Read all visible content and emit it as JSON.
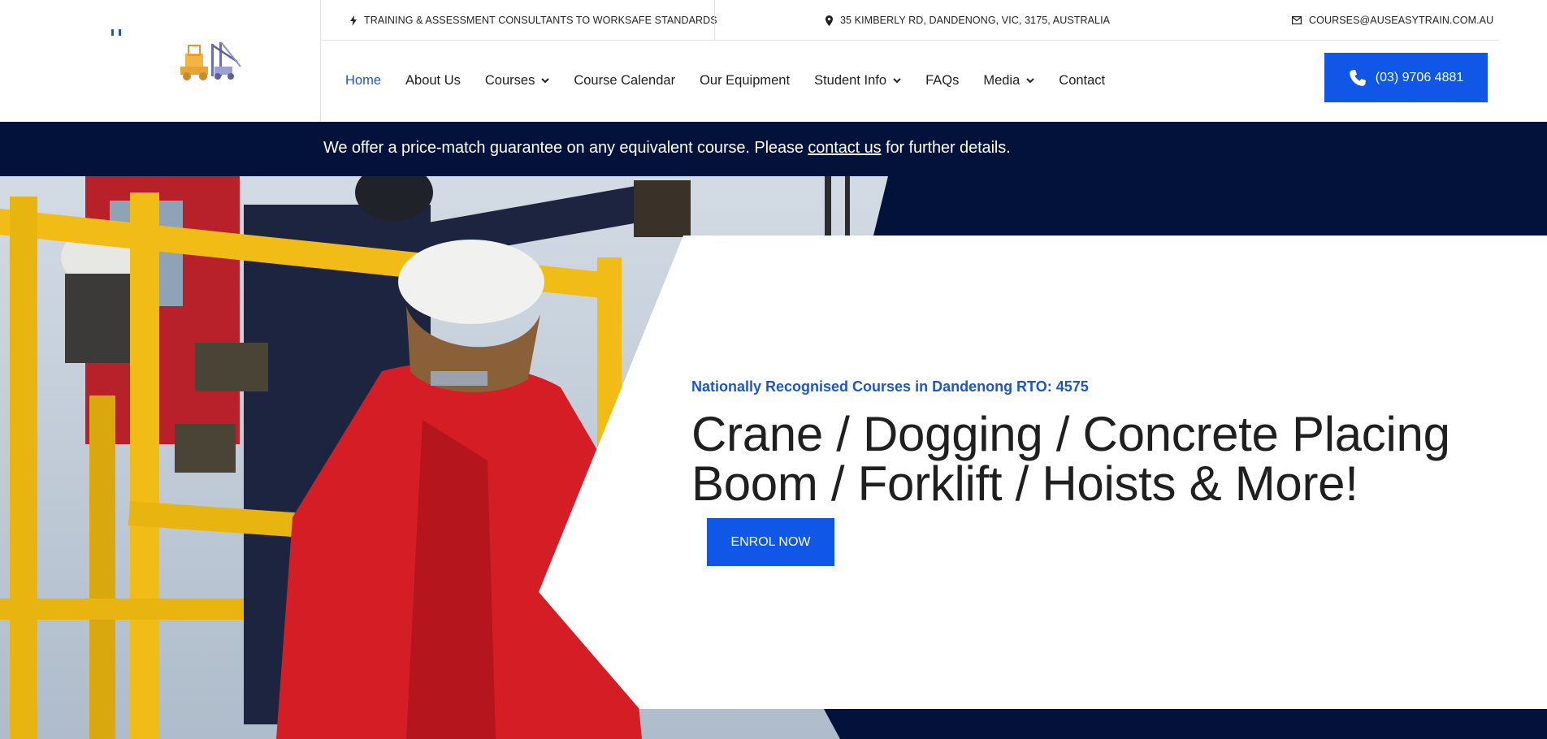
{
  "topbar": {
    "tagline": "TRAINING & ASSESSMENT CONSULTANTS TO WORKSAFE STANDARDS",
    "address": "35 KIMBERLY RD, DANDENONG, VIC, 3175, AUSTRALIA",
    "email": "COURSES@AUSEASYTRAIN.COM.AU",
    "icons": [
      "bolt-icon",
      "map-pin-icon",
      "envelope-icon"
    ]
  },
  "nav": {
    "items": [
      {
        "label": "Home",
        "active": true,
        "dropdown": false
      },
      {
        "label": "About Us",
        "active": false,
        "dropdown": false
      },
      {
        "label": "Courses",
        "active": false,
        "dropdown": true
      },
      {
        "label": "Course Calendar",
        "active": false,
        "dropdown": false
      },
      {
        "label": "Our Equipment",
        "active": false,
        "dropdown": false
      },
      {
        "label": "Student Info",
        "active": false,
        "dropdown": true
      },
      {
        "label": "FAQs",
        "active": false,
        "dropdown": false
      },
      {
        "label": "Media",
        "active": false,
        "dropdown": true
      },
      {
        "label": "Contact",
        "active": false,
        "dropdown": false
      }
    ]
  },
  "phone_button": {
    "label": "(03) 9706 4881",
    "icon": "phone-icon"
  },
  "notice": {
    "before": "We offer a price-match guarantee on any equivalent course. Please ",
    "link": "contact us",
    "after": " for further details."
  },
  "hero": {
    "subtitle": "Nationally Recognised Courses in Dandenong RTO: 4575",
    "title": "Crane / Dogging / Concrete Placing Boom / Forklift / Hoists & More!",
    "cta": "ENROL NOW"
  },
  "colors": {
    "accent": "#1057e8",
    "nav_active": "#1d56c9",
    "navy": "#03123a",
    "text": "#1f1f1f"
  }
}
